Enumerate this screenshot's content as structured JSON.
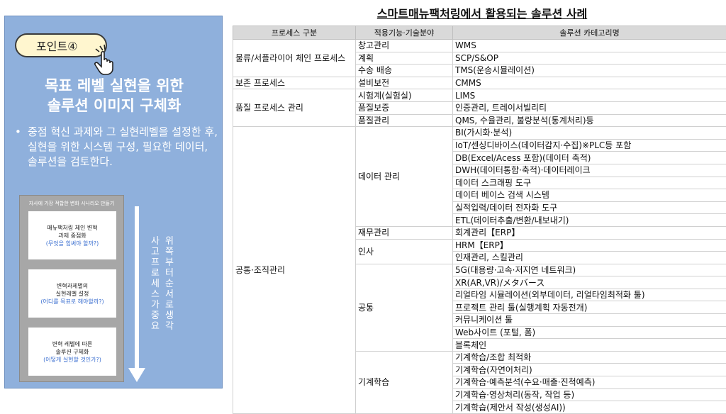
{
  "panel": {
    "point_label": "포인트④",
    "title_line1": "목표 레벨 실현을 위한",
    "title_line2": "솔루션 이미지 구체화",
    "bullet": "•",
    "description": "중점 혁신 과제와 그 실현레벨을 설정한 후, 실현을 위한 시스템 구성, 필요한 데이터, 솔루션을 검토한다.",
    "scenario_header": "자사에 가장 적합한 변화 시나리오 만들기",
    "cards": [
      {
        "line1": "매뉴팩처링 체인 변혁",
        "line2": "과제 중점화",
        "question": "(무엇을 힘써야 할까?)"
      },
      {
        "line1": "변혁과제별의",
        "line2": "실현레벨 설정",
        "question": "(어디를 목표로 해야할까?)"
      },
      {
        "line1": "변혁 레벨에 따른",
        "line2": "솔루션 구체화",
        "question": "(어떻게 실현할 것인가?)"
      }
    ],
    "vertical_left": "사고프로세스가중요",
    "vertical_right": "위쪽부터순서로생각"
  },
  "page_title": "스마트매뉴팩처링에서 활용되는 솔루션 사례",
  "table": {
    "headers": [
      "프로세스 구분",
      "적용기능·기술분야",
      "솔루션 카테고리명"
    ],
    "groups": [
      {
        "process": "물류/서플라이어 체인 프로세스",
        "subs": [
          {
            "name": "창고관리",
            "items": [
              "WMS"
            ]
          },
          {
            "name": "계획",
            "items": [
              "SCP/S&OP"
            ]
          },
          {
            "name": "수송 배송",
            "items": [
              "TMS(운송시뮬레이션)"
            ]
          }
        ]
      },
      {
        "process": "보존 프로세스",
        "subs": [
          {
            "name": "설비보전",
            "items": [
              "CMMS"
            ]
          }
        ]
      },
      {
        "process": "품질 프로세스 관리",
        "subs": [
          {
            "name": "시험계(실험실)",
            "items": [
              "LIMS"
            ]
          },
          {
            "name": "품질보증",
            "items": [
              "인증관리, 트레이서빌리티"
            ]
          },
          {
            "name": "품질관리",
            "items": [
              "QMS, 수율관리, 불량분석(통계처리)등"
            ]
          }
        ]
      },
      {
        "process": "공통·조직관리",
        "subs": [
          {
            "name": "데이터 관리",
            "items": [
              "BI(가시화·분석)",
              "IoT/센싱디바이스(데이터감지·수집)※PLC등 포함",
              "DB(Excel/Acess 포함)(데이터 축적)",
              "DWH(데이터통합·축적)·데이터레이크",
              "데이터 스크래핑 도구",
              "데이터 베이스 검색 시스템",
              "실적입력/데이터 전자화 도구",
              "ETL(데이터추출/변환/내보내기)"
            ]
          },
          {
            "name": "재무관리",
            "items": [
              "회계관리【ERP】"
            ]
          },
          {
            "name": "인사",
            "items": [
              "HRM【ERP】",
              "인재관리, 스킬관리"
            ]
          },
          {
            "name": "공통",
            "items": [
              "5G(대용량·고속·저지연 네트워크)",
              "XR(AR,VR)/メタバース",
              "리얼타임 시뮬레이션(외부데이터, 리얼타임최적화 툴)",
              "프로젝트 관리 툴(실행계획 자동전개)",
              "커뮤니케이션 툴",
              "Web사이트 (포털, 폼)",
              "블록체인"
            ]
          },
          {
            "name": "기계학습",
            "items": [
              "기계학습/조합 최적화",
              "기계학습(자연어처리)",
              "기계학습·예측분석(수요·매출·진척예측)",
              "기계학습·영상처리(동작, 작업 등)",
              "기계학습(제안서 작성(생성AI))"
            ]
          }
        ]
      }
    ]
  }
}
